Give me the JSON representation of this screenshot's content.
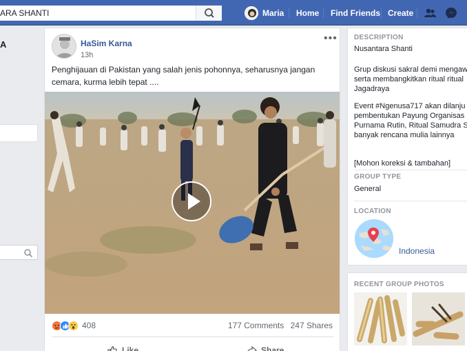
{
  "header": {
    "search_value": "ARA SHANTI",
    "profile_name": "Maria",
    "nav": [
      "Home",
      "Find Friends",
      "Create"
    ],
    "icons": {
      "search": "search-icon",
      "friends": "friends-icon",
      "messenger": "messenger-icon"
    },
    "brand_color": "#4267b2"
  },
  "left": {
    "partial_letter": "A"
  },
  "post": {
    "author": "HaSim Karna",
    "time": "13h",
    "text": "Penghijauan di Pakistan yang salah jenis pohonnya, seharusnya jangan cemara, kurma lebih tepat ....",
    "reaction_count": "408",
    "comments": "177 Comments",
    "shares": "247 Shares",
    "actions": {
      "like": "Like",
      "share": "Share"
    }
  },
  "sidebar": {
    "description_title": "DESCRIPTION",
    "description_lines": [
      "Nusantara Shanti",
      "Grup diskusi sakral demi mengaw",
      "serta membangkitkan ritual ritual",
      "Jagadraya",
      "Event #Ngenusa717 akan dilanju",
      "pembentukan Payung Organisas",
      "Purnama Rutin, Ritual Samudra S",
      "banyak rencana mulia lainnya",
      "[Mohon koreksi & tambahan]"
    ],
    "group_type_title": "GROUP TYPE",
    "group_type": "General",
    "location_title": "LOCATION",
    "location": "Indonesia",
    "photos_title": "RECENT GROUP PHOTOS"
  }
}
